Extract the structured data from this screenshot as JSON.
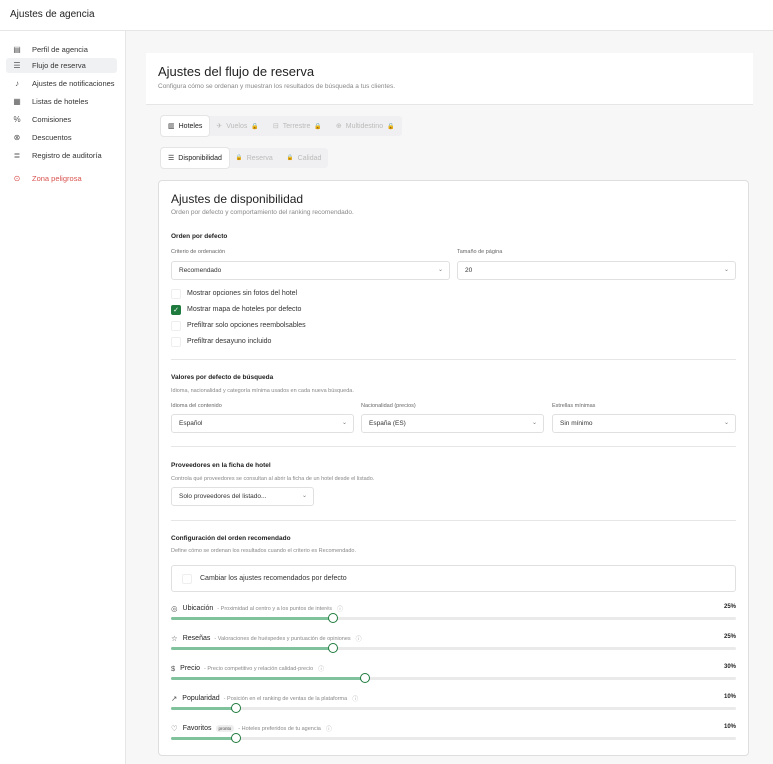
{
  "app": {
    "title": "Ajustes de agencia"
  },
  "sidebar": {
    "items": [
      {
        "label": "Perfil de agencia",
        "icon": "building-icon",
        "glyph": "▤",
        "active": false
      },
      {
        "label": "Flujo de reserva",
        "icon": "sliders-icon",
        "glyph": "☰",
        "active": true
      },
      {
        "label": "Ajustes de notificaciones",
        "icon": "bell-icon",
        "glyph": "♪",
        "active": false
      },
      {
        "label": "Listas de hoteles",
        "icon": "list-icon",
        "glyph": "▦",
        "active": false
      },
      {
        "label": "Comisiones",
        "icon": "percent-icon",
        "glyph": "%",
        "active": false
      },
      {
        "label": "Descuentos",
        "icon": "discount-icon",
        "glyph": "⊗",
        "active": false
      },
      {
        "label": "Registro de auditoría",
        "icon": "scroll-icon",
        "glyph": "≣",
        "active": false
      }
    ],
    "danger": {
      "label": "Zona peligrosa",
      "icon": "alert-icon",
      "glyph": "⊙",
      "color": "#d9534f"
    }
  },
  "header": {
    "title": "Ajustes del flujo de reserva",
    "subtitle": "Configura cómo se ordenan y muestran los resultados de búsqueda a tus clientes."
  },
  "tabs": [
    {
      "label": "Hoteles",
      "icon": "hotel-icon",
      "glyph": "▥",
      "active": true,
      "locked": false
    },
    {
      "label": "Vuelos",
      "icon": "plane-icon",
      "glyph": "✈",
      "active": false,
      "locked": true
    },
    {
      "label": "Terrestre",
      "icon": "car-icon",
      "glyph": "⊟",
      "active": false,
      "locked": true
    },
    {
      "label": "Multidestino",
      "icon": "globe-icon",
      "glyph": "⊕",
      "active": false,
      "locked": true
    }
  ],
  "subtabs": [
    {
      "label": "Disponibilidad",
      "icon": "sliders-icon",
      "glyph": "☰",
      "active": true,
      "locked": false
    },
    {
      "label": "Reserva",
      "icon": "lock-icon",
      "glyph": "🔒",
      "active": false,
      "locked": true
    },
    {
      "label": "Calidad",
      "icon": "lock-icon",
      "glyph": "🔒",
      "active": false,
      "locked": true
    }
  ],
  "availability": {
    "title": "Ajustes de disponibilidad",
    "subtitle": "Orden por defecto y comportamiento del ranking recomendado.",
    "default_order": {
      "title": "Orden por defecto",
      "sort_label": "Criterio de ordenación",
      "sort_value": "Recomendado",
      "page_size_label": "Tamaño de página",
      "page_size_value": "20",
      "checkboxes": [
        {
          "label": "Mostrar opciones sin fotos del hotel",
          "checked": false
        },
        {
          "label": "Mostrar mapa de hoteles por defecto",
          "checked": true
        },
        {
          "label": "Prefiltrar solo opciones reembolsables",
          "checked": false
        },
        {
          "label": "Prefiltrar desayuno incluido",
          "checked": false
        }
      ]
    },
    "search_defaults": {
      "title": "Valores por defecto de búsqueda",
      "desc": "Idioma, nacionalidad y categoría mínima usados en cada nueva búsqueda.",
      "language_label": "Idioma del contenido",
      "language_value": "Español",
      "nationality_label": "Nacionalidad (precios)",
      "nationality_value": "España (ES)",
      "stars_label": "Estrellas mínimas",
      "stars_value": "Sin mínimo"
    },
    "providers": {
      "title": "Proveedores en la ficha de hotel",
      "desc": "Controla qué proveedores se consultan al abrir la ficha de un hotel desde el listado.",
      "value": "Solo proveedores del listado..."
    },
    "recommended": {
      "title": "Configuración del orden recomendado",
      "desc": "Define cómo se ordenan los resultados cuando el criterio es Recomendado.",
      "override_label": "Cambiar los ajustes recomendados por defecto",
      "override_checked": false,
      "weights": [
        {
          "label": "Ubicación",
          "desc": "- Proximidad al centro y a los puntos de interés",
          "icon": "pin-icon",
          "glyph": "◎",
          "value": 25,
          "pct": "25%",
          "badge": ""
        },
        {
          "label": "Reseñas",
          "desc": "- Valoraciones de huéspedes y puntuación de opiniones",
          "icon": "star-icon",
          "glyph": "☆",
          "value": 25,
          "pct": "25%",
          "badge": ""
        },
        {
          "label": "Precio",
          "desc": "- Precio competitivo y relación calidad-precio",
          "icon": "dollar-icon",
          "glyph": "$",
          "value": 30,
          "pct": "30%",
          "badge": ""
        },
        {
          "label": "Popularidad",
          "desc": "- Posición en el ranking de ventas de la plataforma",
          "icon": "trend-icon",
          "glyph": "↗",
          "value": 10,
          "pct": "10%",
          "badge": ""
        },
        {
          "label": "Favoritos",
          "desc": "- Hoteles preferidos de tu agencia",
          "icon": "heart-icon",
          "glyph": "♡",
          "value": 10,
          "pct": "10%",
          "badge": "pronto"
        }
      ]
    }
  },
  "colors": {
    "accent": "#1e7a3d",
    "slider_fill": "#7fc29b",
    "danger": "#d9534f"
  }
}
